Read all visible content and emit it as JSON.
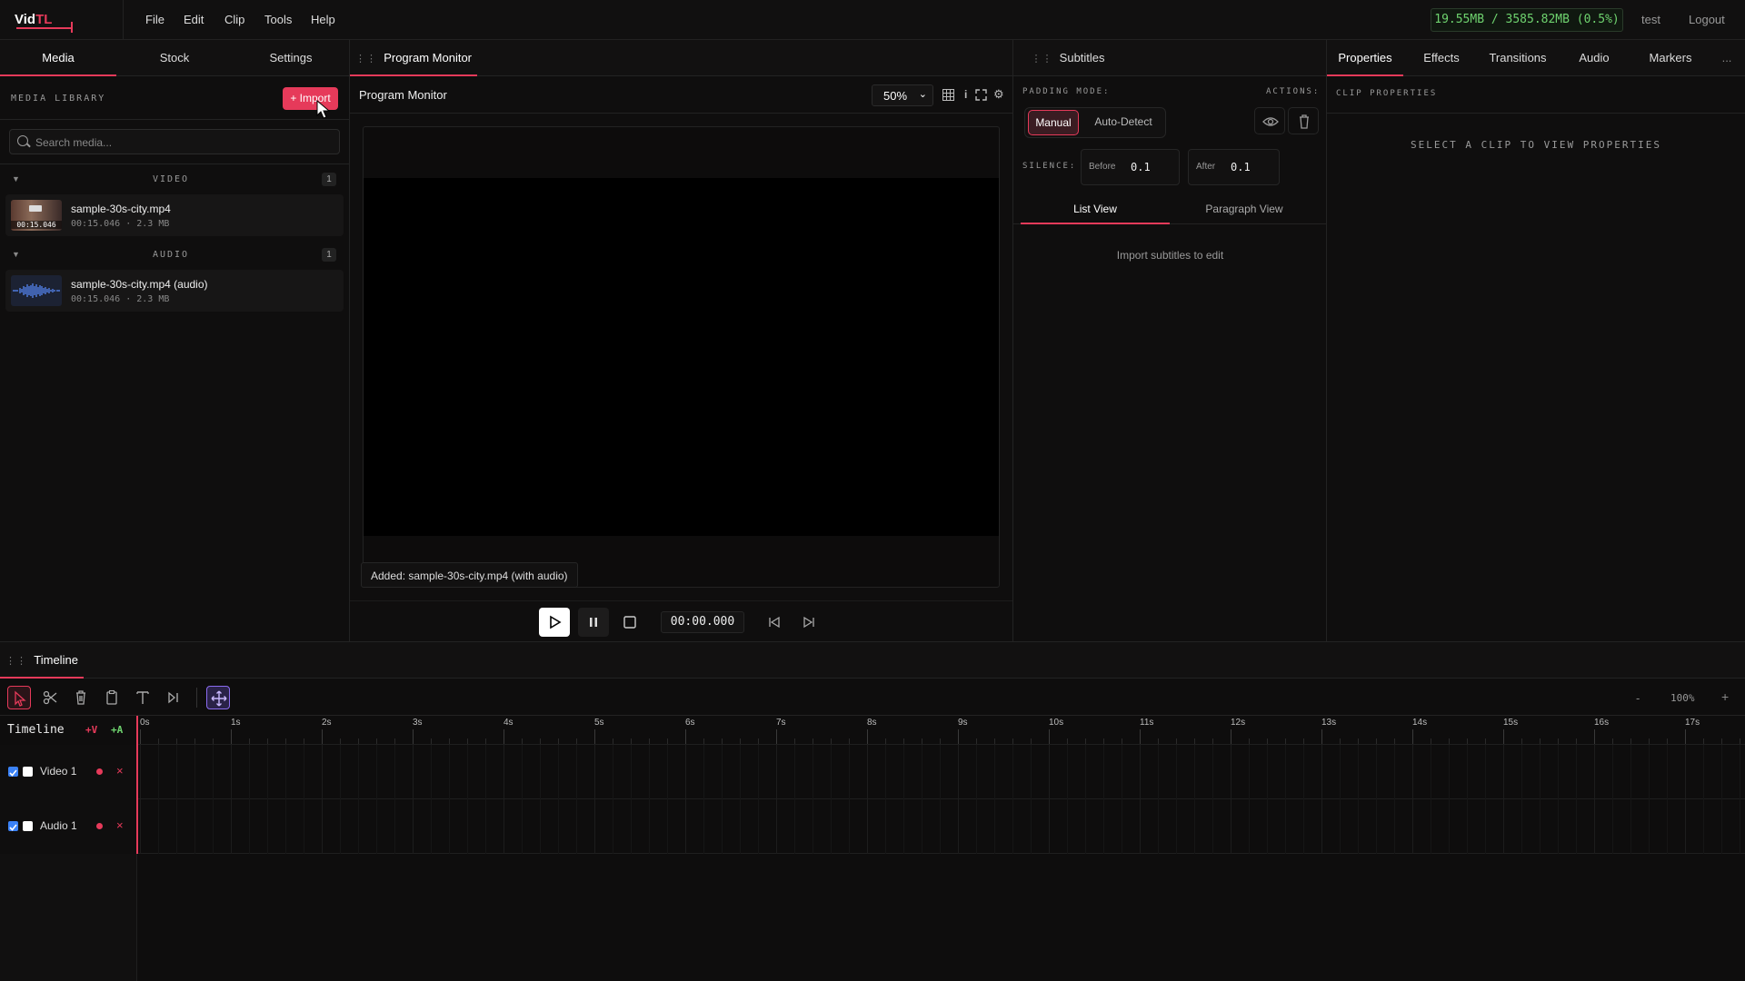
{
  "app": {
    "logo_main": "Vid",
    "logo_accent": "TL"
  },
  "menu": [
    "File",
    "Edit",
    "Clip",
    "Tools",
    "Help"
  ],
  "header": {
    "memory": "19.55MB / 3585.82MB (0.5%)",
    "user": "test",
    "logout": "Logout"
  },
  "left_tabs": [
    "Media",
    "Stock",
    "Settings"
  ],
  "media": {
    "title": "MEDIA LIBRARY",
    "import_label": "+ Import",
    "search_placeholder": "Search media...",
    "sections": [
      {
        "name": "VIDEO",
        "count": "1",
        "items": [
          {
            "name": "sample-30s-city.mp4",
            "meta": "00:15.046 · 2.3 MB",
            "thumb_tc": "00:15.046"
          }
        ]
      },
      {
        "name": "AUDIO",
        "count": "1",
        "items": [
          {
            "name": "sample-30s-city.mp4 (audio)",
            "meta": "00:15.046 · 2.3 MB"
          }
        ]
      }
    ]
  },
  "monitor": {
    "tab": "Program Monitor",
    "title": "Program Monitor",
    "zoom": "50%",
    "toast": "Added: sample-30s-city.mp4 (with audio)",
    "timecode": "00:00.000"
  },
  "subtitles": {
    "tab": "Subtitles",
    "padding_label": "PADDING MODE:",
    "actions_label": "ACTIONS:",
    "mode_manual": "Manual",
    "mode_auto": "Auto-Detect",
    "silence_label": "SILENCE:",
    "before_label": "Before",
    "before_value": "0.1",
    "after_label": "After",
    "after_value": "0.1",
    "view_list": "List View",
    "view_paragraph": "Paragraph View",
    "empty": "Import subtitles to edit"
  },
  "right_tabs": [
    "Properties",
    "Effects",
    "Transitions",
    "Audio",
    "Markers"
  ],
  "right_more": "...",
  "properties": {
    "title": "CLIP PROPERTIES",
    "empty": "SELECT A CLIP TO VIEW PROPERTIES"
  },
  "timeline": {
    "tab": "Timeline",
    "label": "Timeline",
    "add_video": "+V",
    "add_audio": "+A",
    "zoom_minus": "-",
    "zoom": "100%",
    "zoom_plus": "+",
    "ruler": [
      "0s",
      "1s",
      "2s",
      "3s",
      "4s",
      "5s",
      "6s",
      "7s",
      "8s",
      "9s",
      "10s",
      "11s",
      "12s",
      "13s",
      "14s",
      "15s",
      "16s",
      "17s"
    ],
    "tracks": [
      {
        "name": "Video 1"
      },
      {
        "name": "Audio 1"
      }
    ],
    "close": "×"
  },
  "colors": {
    "accent": "#e63a5a",
    "memory_green": "#6fd36f",
    "tool_purple": "#8b6cf0"
  }
}
